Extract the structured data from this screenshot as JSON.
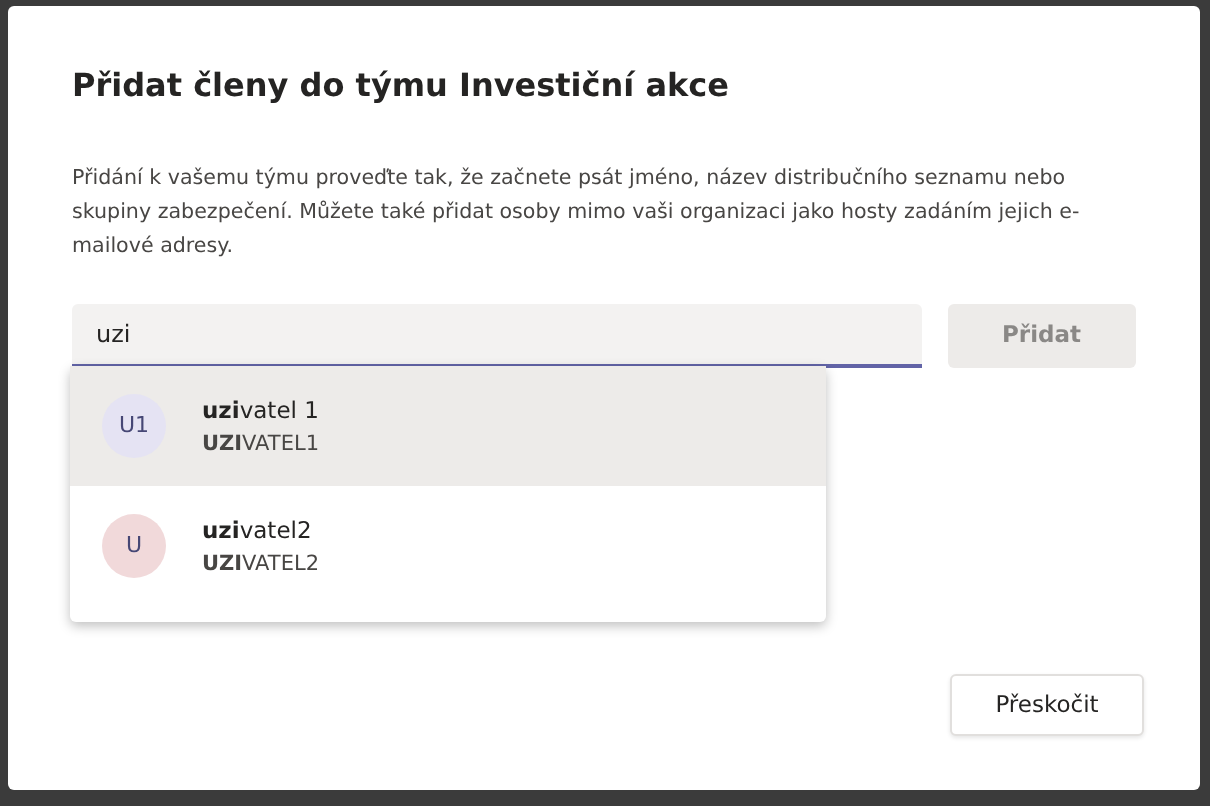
{
  "dialog": {
    "title": "Přidat členy do týmu Investiční akce",
    "description": "Přidání k vašemu týmu proveďte tak, že začnete psát jméno, název distribučního seznamu nebo skupiny zabezpečení. Můžete také přidat osoby mimo vaši organizaci jako hosty zadáním jejich e-mailové adresy."
  },
  "search": {
    "value": "uzi"
  },
  "add_button": {
    "label": "Přidat",
    "disabled": true
  },
  "suggestions": [
    {
      "initials": "U1",
      "name": "**uzi**vatel 1",
      "account": "**UZI**VATEL1",
      "color": "#e5e3f3",
      "selected": true
    },
    {
      "initials": "U",
      "name": "**uzi**vatel2",
      "account": "**UZI**VATEL2",
      "color": "#f1d9da",
      "selected": false
    }
  ],
  "skip_button": {
    "label": "Přeskočit"
  }
}
